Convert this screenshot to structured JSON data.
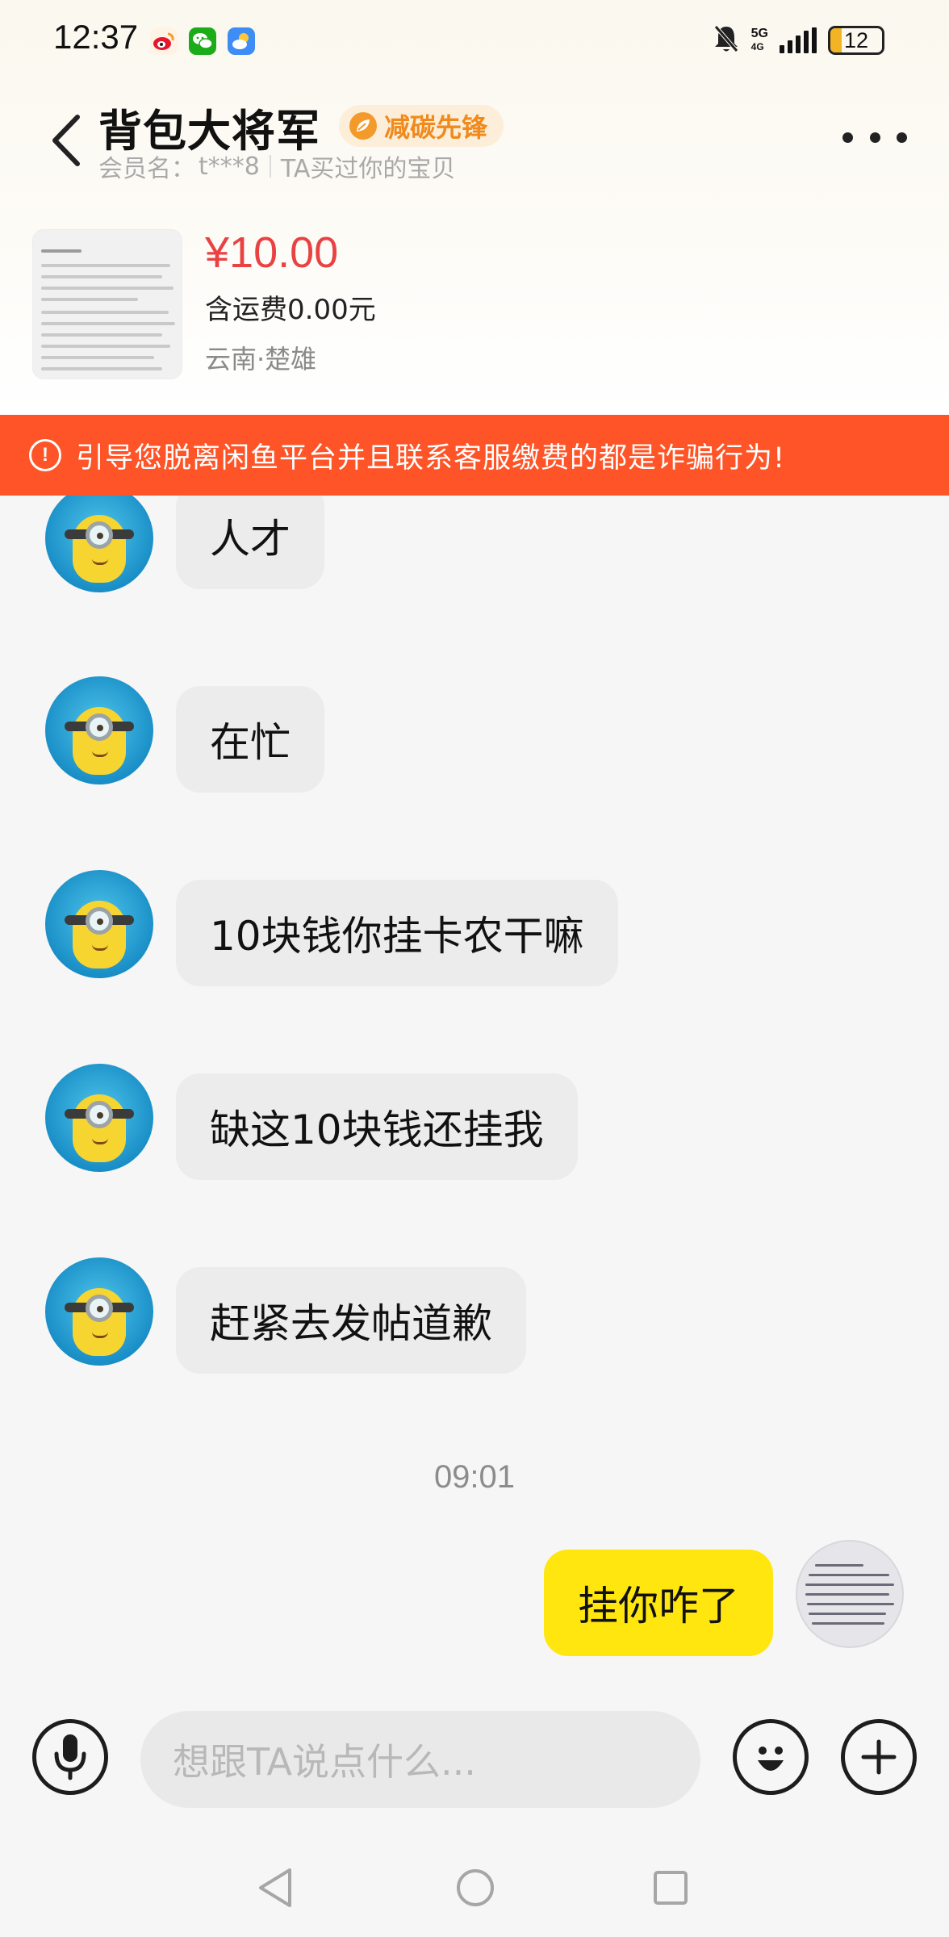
{
  "status_bar": {
    "time": "12:37",
    "network": "5G",
    "network_sub": "4G",
    "battery": "12"
  },
  "header": {
    "name": "背包大将军",
    "badge": "减碳先锋",
    "member_label": "会员名：",
    "member_id": "t***8",
    "relation": "TA买过你的宝贝"
  },
  "product": {
    "price": "¥10.00",
    "shipping": "含运费0.00元",
    "location": "云南·楚雄"
  },
  "warning": {
    "text": "引导您脱离闲鱼平台并且联系客服缴费的都是诈骗行为!"
  },
  "messages": [
    {
      "side": "in",
      "text": "人才"
    },
    {
      "side": "in",
      "text": "在忙"
    },
    {
      "side": "in",
      "text": "10块钱你挂卡农干嘛"
    },
    {
      "side": "in",
      "text": "缺这10块钱还挂我"
    },
    {
      "side": "in",
      "text": "赶紧去发帖道歉"
    },
    {
      "side": "time",
      "text": "09:01"
    },
    {
      "side": "out",
      "text": "挂你咋了"
    }
  ],
  "input": {
    "placeholder": "想跟TA说点什么..."
  },
  "colors": {
    "accent_yellow": "#ffe60f",
    "warning_orange": "#fe5427",
    "price_red": "#e94242",
    "badge_orange": "#f08a1c"
  },
  "icons": [
    "weibo-icon",
    "wechat-icon",
    "weather-icon",
    "mute-bell-icon",
    "back-icon",
    "more-icon",
    "warning-icon",
    "voice-icon",
    "emoji-icon",
    "plus-icon",
    "nav-back-icon",
    "nav-home-icon",
    "nav-recent-icon"
  ]
}
